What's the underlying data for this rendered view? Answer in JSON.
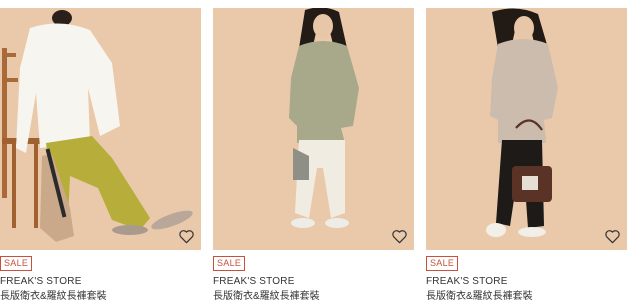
{
  "colors": {
    "photo_background": "#eac9ab",
    "sale_badge": "#c8513d",
    "text": "#333333"
  },
  "products": [
    {
      "badge": "SALE",
      "brand": "FREAK'S STORE",
      "title": "長版衛衣&羅紋長褲套裝",
      "favorite_icon": "heart-outline-icon",
      "image_desc_icon": "product-photo"
    },
    {
      "badge": "SALE",
      "brand": "FREAK'S STORE",
      "title": "長版衛衣&羅紋長褲套裝",
      "favorite_icon": "heart-outline-icon",
      "image_desc_icon": "product-photo"
    },
    {
      "badge": "SALE",
      "brand": "FREAK'S STORE",
      "title": "長版衛衣&羅紋長褲套裝",
      "favorite_icon": "heart-outline-icon",
      "image_desc_icon": "product-photo"
    }
  ]
}
